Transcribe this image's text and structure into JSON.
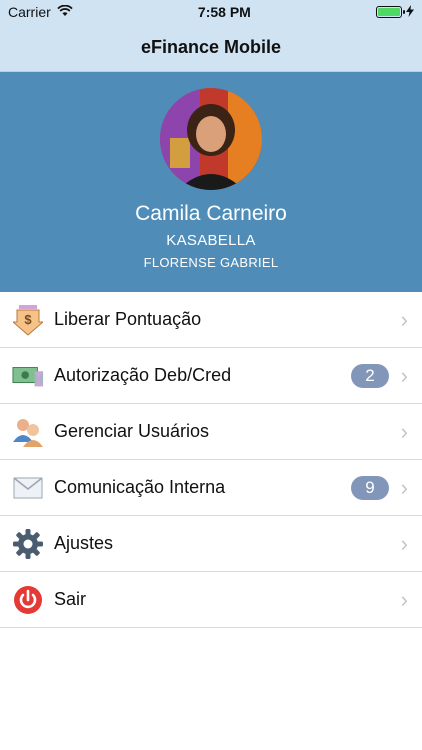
{
  "status_bar": {
    "carrier": "Carrier",
    "time": "7:58 PM",
    "battery_level": 1.0
  },
  "nav": {
    "title": "eFinance Mobile"
  },
  "profile": {
    "name": "Camila Carneiro",
    "company": "KASABELLA",
    "person": "FLORENSE GABRIEL"
  },
  "menu": [
    {
      "label": "Liberar Pontuação",
      "icon": "money-download-icon",
      "badge": ""
    },
    {
      "label": "Autorização Deb/Cred",
      "icon": "cash-hourglass-icon",
      "badge": "2"
    },
    {
      "label": "Gerenciar Usuários",
      "icon": "users-icon",
      "badge": ""
    },
    {
      "label": "Comunicação Interna",
      "icon": "envelope-icon",
      "badge": "9"
    },
    {
      "label": "Ajustes",
      "icon": "gear-icon",
      "badge": ""
    },
    {
      "label": "Sair",
      "icon": "power-icon",
      "badge": ""
    }
  ],
  "colors": {
    "nav_bg": "#cfe3f3",
    "profile_bg": "#4f8db8",
    "badge_bg": "#8196b8",
    "power_red": "#e53935"
  }
}
